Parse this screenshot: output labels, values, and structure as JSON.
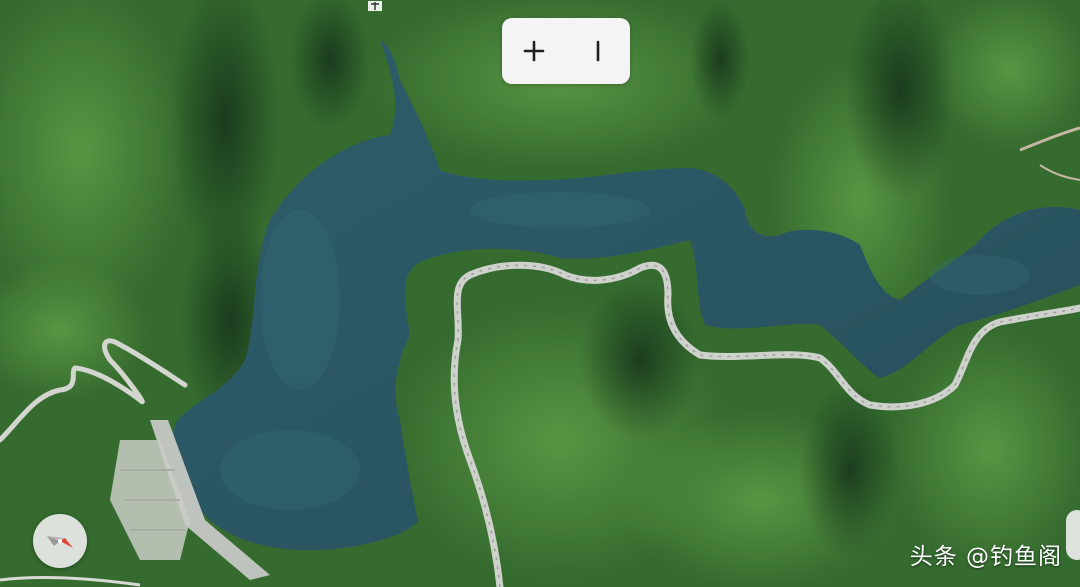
{
  "map": {
    "view": "satellite",
    "features": [
      "reservoir",
      "dam",
      "winding-road",
      "forested-hills"
    ],
    "colors": {
      "water": "#2c5a66",
      "forest": "#3f7a35",
      "forest_dark": "#1f3f1d",
      "road": "#c9ccc6",
      "dam": "#bfc3bd"
    }
  },
  "controls": {
    "zoom_in_icon": "plus-icon",
    "zoom_out_icon": "minus-icon",
    "compass_icon": "compass-icon"
  },
  "watermark": {
    "text": "头条 @钓鱼阁"
  }
}
